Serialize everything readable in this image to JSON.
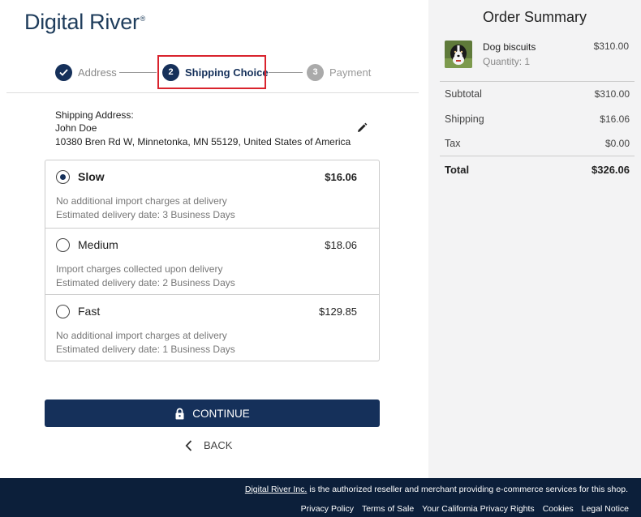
{
  "brand": {
    "logo_text": "Digital River",
    "logo_mark": "®"
  },
  "stepper": {
    "steps": [
      {
        "number": "",
        "label": "Address",
        "state": "done"
      },
      {
        "number": "2",
        "label": "Shipping Choice",
        "state": "active"
      },
      {
        "number": "3",
        "label": "Payment",
        "state": "pending"
      }
    ]
  },
  "shipping_address": {
    "heading": "Shipping Address:",
    "name": "John Doe",
    "address": "10380 Bren Rd W, Minnetonka, MN 55129, United States of America"
  },
  "shipping_options": [
    {
      "name": "Slow",
      "price": "$16.06",
      "line1": "No additional import charges at delivery",
      "line2": "Estimated delivery date: 3 Business Days",
      "selected": true
    },
    {
      "name": "Medium",
      "price": "$18.06",
      "line1": "Import charges collected upon delivery",
      "line2": "Estimated delivery date: 2 Business Days",
      "selected": false
    },
    {
      "name": "Fast",
      "price": "$129.85",
      "line1": "No additional import charges at delivery",
      "line2": "Estimated delivery date: 1 Business Days",
      "selected": false
    }
  ],
  "actions": {
    "continue_label": "CONTINUE",
    "back_label": "BACK"
  },
  "order_summary": {
    "title": "Order Summary",
    "item": {
      "name": "Dog biscuits",
      "quantity": "Quantity: 1",
      "price": "$310.00"
    },
    "rows": [
      {
        "label": "Subtotal",
        "value": "$310.00"
      },
      {
        "label": "Shipping",
        "value": "$16.06"
      },
      {
        "label": "Tax",
        "value": "$0.00"
      }
    ],
    "total": {
      "label": "Total",
      "value": "$326.06"
    }
  },
  "footer": {
    "company_link": "Digital River Inc.",
    "notice": " is the authorized reseller and merchant providing e-commerce services for this shop.",
    "links": [
      "Privacy Policy",
      "Terms of Sale",
      "Your California Privacy Rights",
      "Cookies",
      "Legal Notice"
    ]
  },
  "colors": {
    "primary": "#15305a",
    "highlight": "#d9232d",
    "footer": "#0c1f3a",
    "summary_bg": "#f3f3f4"
  }
}
